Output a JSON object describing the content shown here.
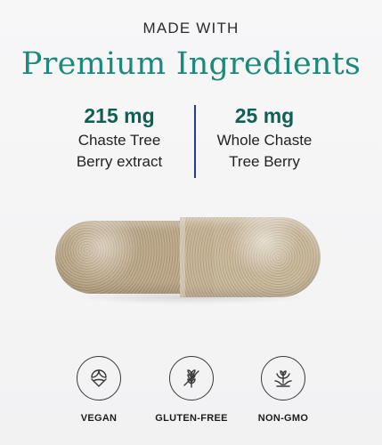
{
  "header": {
    "kicker": "MADE WITH",
    "headline": "Premium Ingredients"
  },
  "stats": [
    {
      "amount": "215 mg",
      "line1": "Chaste Tree",
      "line2": "Berry extract"
    },
    {
      "amount": "25 mg",
      "line1": "Whole Chaste",
      "line2": "Tree Berry"
    }
  ],
  "features": [
    {
      "label": "VEGAN",
      "icon": "vegan-leaf-icon"
    },
    {
      "label": "GLUTEN-FREE",
      "icon": "gluten-free-wheat-icon"
    },
    {
      "label": "NON-GMO",
      "icon": "non-gmo-plant-icon"
    }
  ],
  "colors": {
    "headline": "#1b8a7a",
    "amount": "#0f5f52",
    "divider": "#1f3f8a",
    "icon_stroke": "#3a3a3a"
  }
}
